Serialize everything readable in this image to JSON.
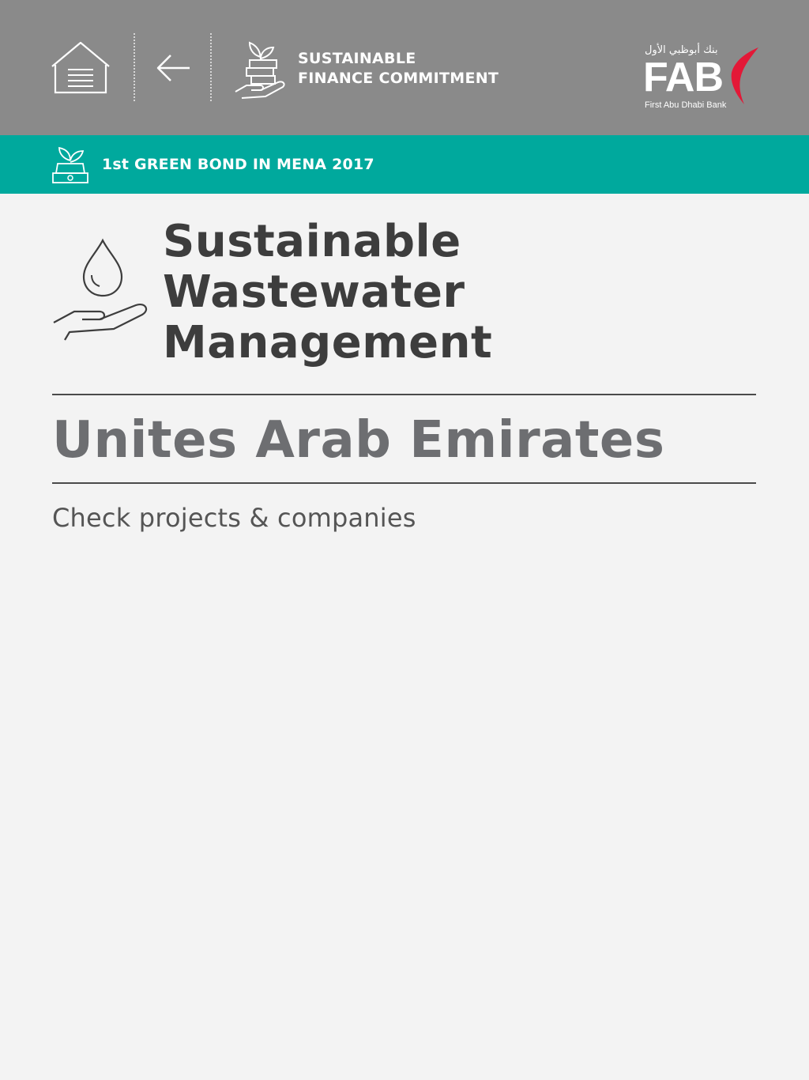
{
  "header": {
    "home_icon": "home-icon",
    "back_icon": "arrow-left-icon",
    "section_icon": "hand-plant-money-icon",
    "section_title_line1": "SUSTAINABLE",
    "section_title_line2": "FINANCE COMMITMENT",
    "background_color": "#8a8a8a"
  },
  "logo": {
    "arabic": "بنك أبوظبي الأول",
    "text": "FAB",
    "subtitle": "First Abu Dhabi Bank",
    "accent_color": "#e31837"
  },
  "banner": {
    "icon": "plant-money-icon",
    "text": "1st GREEN BOND IN MENA 2017",
    "background_color": "#00a99d"
  },
  "main": {
    "icon": "water-drop-hand-icon",
    "title_line1": "Sustainable",
    "title_line2": "Wastewater",
    "title_line3": "Management",
    "country": "Unites Arab Emirates",
    "link": "Check projects & companies"
  }
}
